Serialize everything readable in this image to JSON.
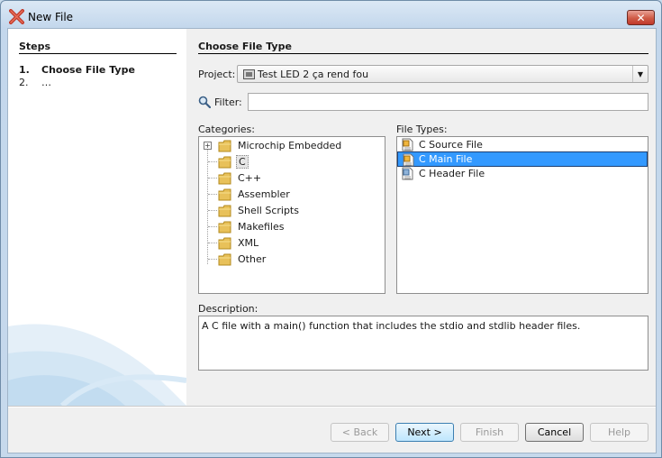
{
  "window": {
    "title": "New File",
    "close_label": "✕"
  },
  "steps": {
    "title": "Steps",
    "items": [
      {
        "num": "1.",
        "label": "Choose File Type"
      },
      {
        "num": "2.",
        "label": "…"
      }
    ]
  },
  "main": {
    "title": "Choose File Type",
    "project_label": "Project:",
    "project_value": "Test LED 2 ça rend fou",
    "filter_label": "Filter:",
    "filter_value": "",
    "categories_label": "Categories:",
    "categories": [
      "Microchip Embedded",
      "C",
      "C++",
      "Assembler",
      "Shell Scripts",
      "Makefiles",
      "XML",
      "Other"
    ],
    "file_types_label": "File Types:",
    "file_types": [
      "C Source File",
      "C Main File",
      "C Header File"
    ],
    "description_label": "Description:",
    "description": "A C file with a main() function that includes the stdio and stdlib header files."
  },
  "buttons": {
    "back": "< Back",
    "next": "Next >",
    "finish": "Finish",
    "cancel": "Cancel",
    "help": "Help"
  },
  "colors": {
    "selection": "#3399ff",
    "title_bar": "#c3d7ec",
    "close_button": "#c0392b"
  }
}
